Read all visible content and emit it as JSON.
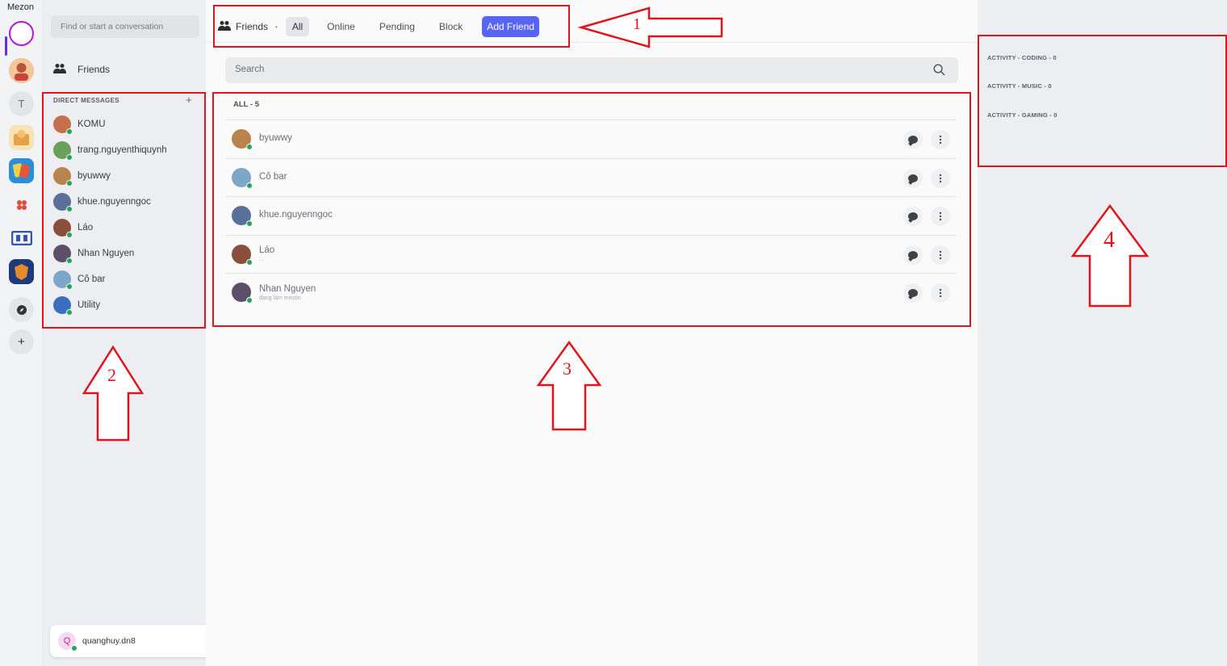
{
  "app": {
    "title": "Mezon"
  },
  "window_controls": {
    "minimize": "–",
    "maximize": "◻",
    "close": "✕"
  },
  "rail": {
    "servers": [
      {
        "name": "home",
        "icon": "mezon-home-icon"
      },
      {
        "name": "avatar-server",
        "color": "#e49a5a"
      },
      {
        "name": "server-t",
        "label": "T"
      },
      {
        "name": "food-server",
        "color": "#e6b75a"
      },
      {
        "name": "cards-server",
        "color": "#e5573b"
      },
      {
        "name": "flower-server",
        "color": "#e14b3b"
      },
      {
        "name": "brand-server",
        "color": "#3355aa"
      },
      {
        "name": "shield-server",
        "color": "#1e3a7a"
      }
    ],
    "explore": "⊘",
    "add": "+"
  },
  "dm": {
    "search_placeholder": "Find or start a conversation",
    "friends_label": "Friends",
    "header": "DIRECT MESSAGES",
    "add": "+",
    "items": [
      {
        "name": "KOMU",
        "color": "#c66f4d"
      },
      {
        "name": "trang.nguyenthiquynh",
        "color": "#6aa05a"
      },
      {
        "name": "byuwwy",
        "color": "#b9834e"
      },
      {
        "name": "khue.nguyenngoc",
        "color": "#5a6f9a"
      },
      {
        "name": "Láo",
        "color": "#8a4f3c"
      },
      {
        "name": "Nhan Nguyen",
        "color": "#5d4f6a"
      },
      {
        "name": "Cô bar",
        "color": "#7da6c8"
      },
      {
        "name": "Utility",
        "color": "#3a6fc0"
      }
    ],
    "user": {
      "name": "quanghuy.dn8",
      "initial": "Q",
      "settings_icon": "⚙"
    }
  },
  "topbar": {
    "friends": "Friends",
    "dot": "•",
    "tabs": [
      "All",
      "Online",
      "Pending",
      "Block"
    ],
    "add_friend": "Add Friend"
  },
  "main": {
    "search_placeholder": "Search",
    "count_label": "ALL - 5",
    "friends": [
      {
        "name": "byuwwy",
        "sub": "",
        "color": "#b9834e"
      },
      {
        "name": "Cô bar",
        "sub": "",
        "color": "#7da6c8"
      },
      {
        "name": "khue.nguyenngoc",
        "sub": "",
        "color": "#5a6f9a"
      },
      {
        "name": "Láo",
        "sub": "...",
        "color": "#8a4f3c"
      },
      {
        "name": "Nhan Nguyen",
        "sub": "đang làm mezon",
        "color": "#5d4f6a"
      }
    ]
  },
  "activity": {
    "coding": "ACTIVITY - CODING - 0",
    "music": "ACTIVITY - MUSIC - 0",
    "gaming": "ACTIVITY - GAMING - 0"
  },
  "annotations": {
    "n1": "1",
    "n2": "2",
    "n3": "3",
    "n4": "4",
    "color": "#e0141c"
  },
  "icons": {
    "friends": "friends-icon",
    "search": "search-icon",
    "message": "message-icon",
    "more": "more-icon"
  }
}
